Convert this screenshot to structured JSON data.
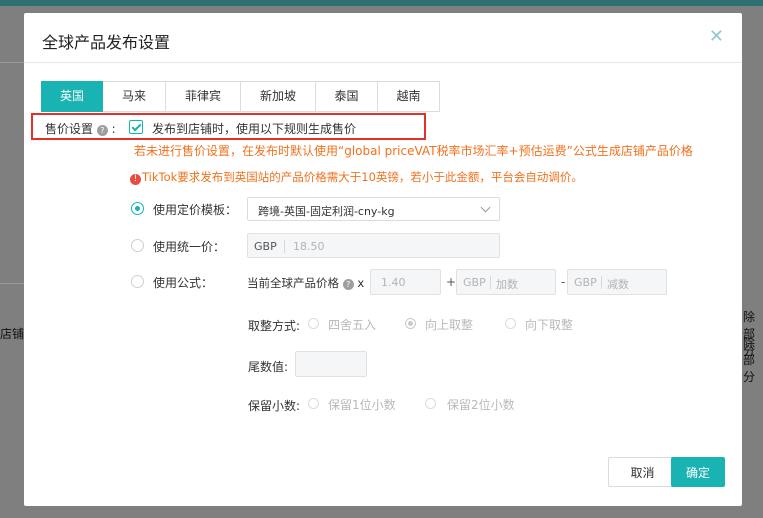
{
  "background": {
    "left_text": "店铺",
    "right_text_1": "除部分",
    "right_text_2": "除部分"
  },
  "dialog": {
    "title": "全球产品发布设置",
    "close_icon": "close-icon",
    "tabs": [
      {
        "label": "英国",
        "active": true
      },
      {
        "label": "马来",
        "active": false
      },
      {
        "label": "菲律宾",
        "active": false
      },
      {
        "label": "新加坡",
        "active": false
      },
      {
        "label": "泰国",
        "active": false
      },
      {
        "label": "越南",
        "active": false
      }
    ],
    "price_setting": {
      "label": "售价设置",
      "help_icon": "question-icon",
      "colon": ":",
      "checkbox_checked": true,
      "checkbox_label": "发布到店铺时，使用以下规则生成售价",
      "note": "若未进行售价设置，在发布时默认使用“global priceVAT税率市场汇率+预估运费”公式生成店铺产品价格",
      "warning": "TikTok要求发布到英国站的产品价格需大于10英镑，若小于此金额，平台会自动调价。"
    },
    "options": {
      "template": {
        "label": "使用定价模板：",
        "selected": true,
        "value": "跨境-英国-固定利润-cny-kg"
      },
      "unified": {
        "label": "使用统一价：",
        "selected": false,
        "currency": "GBP",
        "placeholder": "18.50"
      },
      "formula": {
        "label": "使用公式：",
        "selected": false,
        "prefix_text": "当前全球产品价格",
        "multiply": "x",
        "multiplier_placeholder": "1.40",
        "plus": "+",
        "add_currency": "GBP",
        "add_placeholder": "加数",
        "minus": "-",
        "sub_currency": "GBP",
        "sub_placeholder": "减数"
      },
      "rounding": {
        "label": "取整方式:",
        "choices": [
          "四舍五入",
          "向上取整",
          "向下取整"
        ],
        "selected": "向上取整"
      },
      "tail": {
        "label": "尾数值:"
      },
      "decimals": {
        "label": "保留小数:",
        "choices": [
          "保留1位小数",
          "保留2位小数"
        ]
      }
    },
    "buttons": {
      "cancel": "取消",
      "ok": "确定"
    },
    "colors": {
      "accent": "#1ab3b3",
      "warning": "#f2711c",
      "highlight": "#e0312b"
    }
  }
}
